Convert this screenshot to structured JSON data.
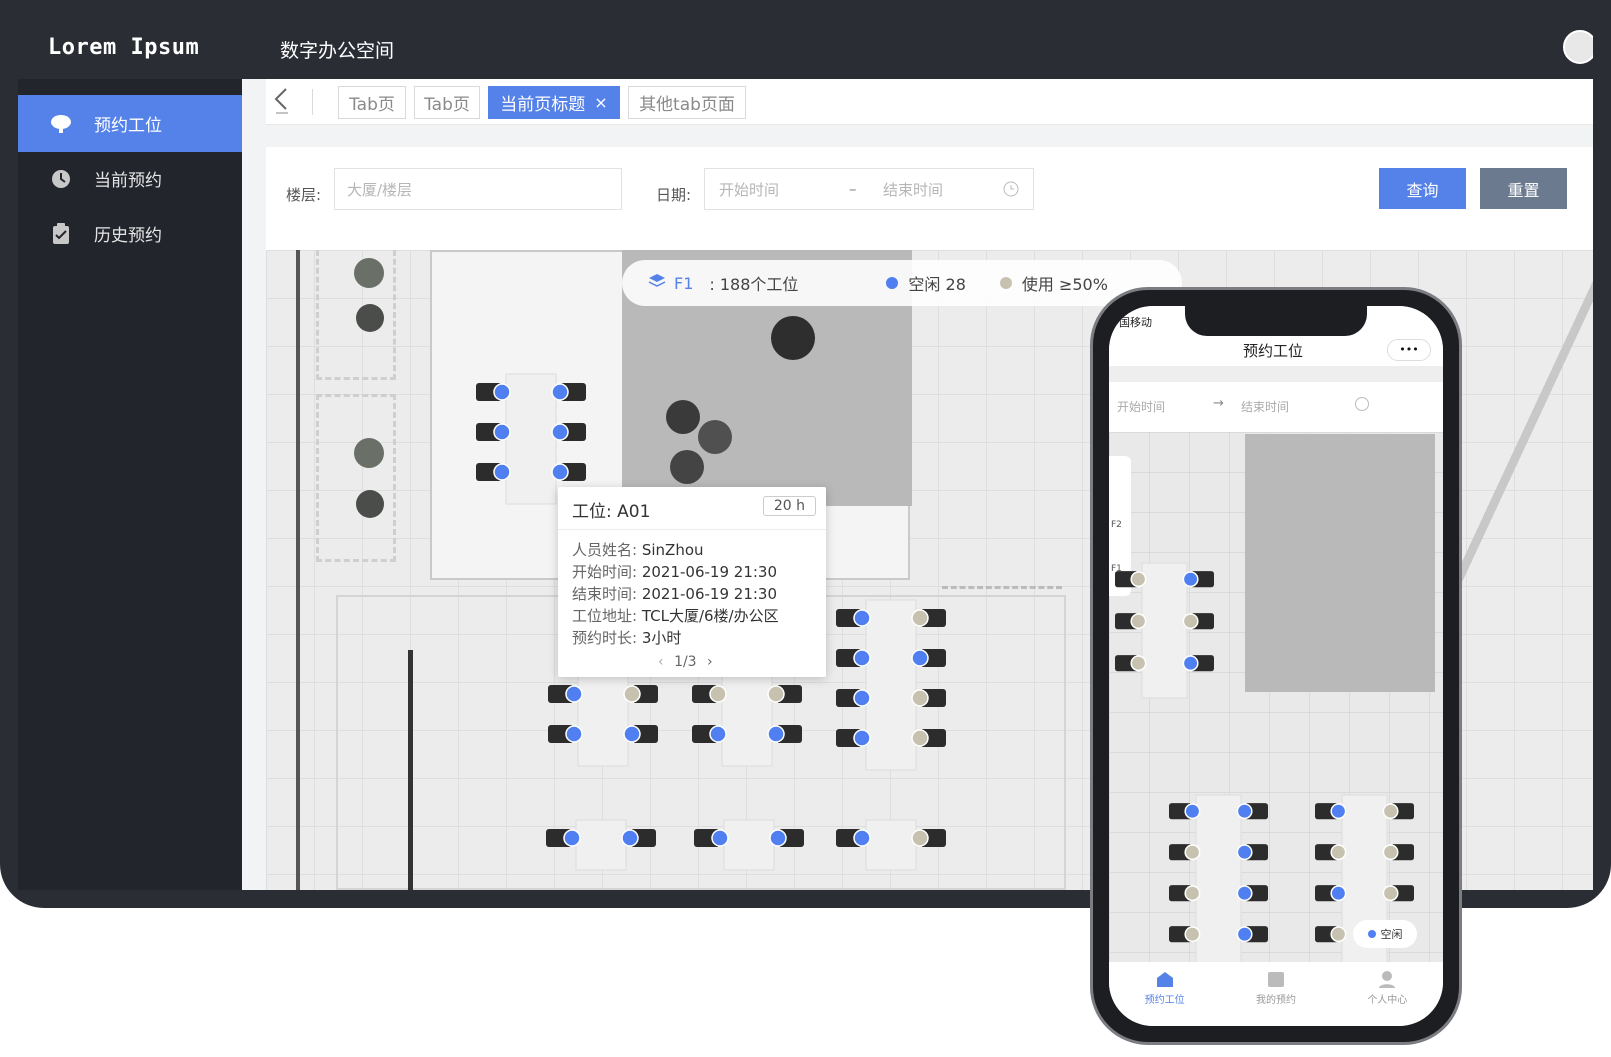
{
  "app": {
    "logo": "Lorem Ipsum",
    "title": "数字办公空间"
  },
  "sidebar": {
    "items": [
      {
        "label": "预约工位",
        "icon": "chat-bubble-icon",
        "active": true
      },
      {
        "label": "当前预约",
        "icon": "clock-icon",
        "active": false
      },
      {
        "label": "历史预约",
        "icon": "clipboard-icon",
        "active": false
      }
    ]
  },
  "tabs": [
    {
      "label": "Tab页",
      "active": false
    },
    {
      "label": "Tab页",
      "active": false
    },
    {
      "label": "当前页标题",
      "active": true,
      "close": "×"
    },
    {
      "label": "其他tab页面",
      "active": false
    }
  ],
  "filter": {
    "floor_label": "楼层:",
    "floor_placeholder": "大厦/楼层",
    "date_label": "日期:",
    "start_placeholder": "开始时间",
    "dash": "–",
    "end_placeholder": "结束时间",
    "query": "查询",
    "reset": "重置"
  },
  "status": {
    "floor": "F1",
    "count": ": 188个工位",
    "free": "空闲 28",
    "used": "使用 ≥50%"
  },
  "tooltip": {
    "title": "工位: A01",
    "duration": "20 h",
    "rows": [
      {
        "k": "人员姓名:",
        "v": "SinZhou"
      },
      {
        "k": "开始时间:",
        "v": "2021-06-19 21:30"
      },
      {
        "k": "结束时间:",
        "v": "2021-06-19 21:30"
      },
      {
        "k": "工位地址:",
        "v": "TCL大厦/6楼/办公区"
      },
      {
        "k": "预约时长:",
        "v": "3小时"
      }
    ],
    "pager": "1/3"
  },
  "phone": {
    "carrier": "国移动",
    "title": "预约工位",
    "more": "•••",
    "start": "开始时间",
    "arrow": "→",
    "end": "结束时间",
    "legend": "空闲",
    "floors": [
      "F2",
      "F1"
    ],
    "tabs": [
      {
        "label": "预约工位",
        "active": true
      },
      {
        "label": "我的预约",
        "active": false
      },
      {
        "label": "个人中心",
        "active": false
      }
    ]
  },
  "colors": {
    "accent": "#5582e8",
    "dark": "#2b2d35",
    "sidebar": "#23252d",
    "reset": "#6b7a8f"
  }
}
